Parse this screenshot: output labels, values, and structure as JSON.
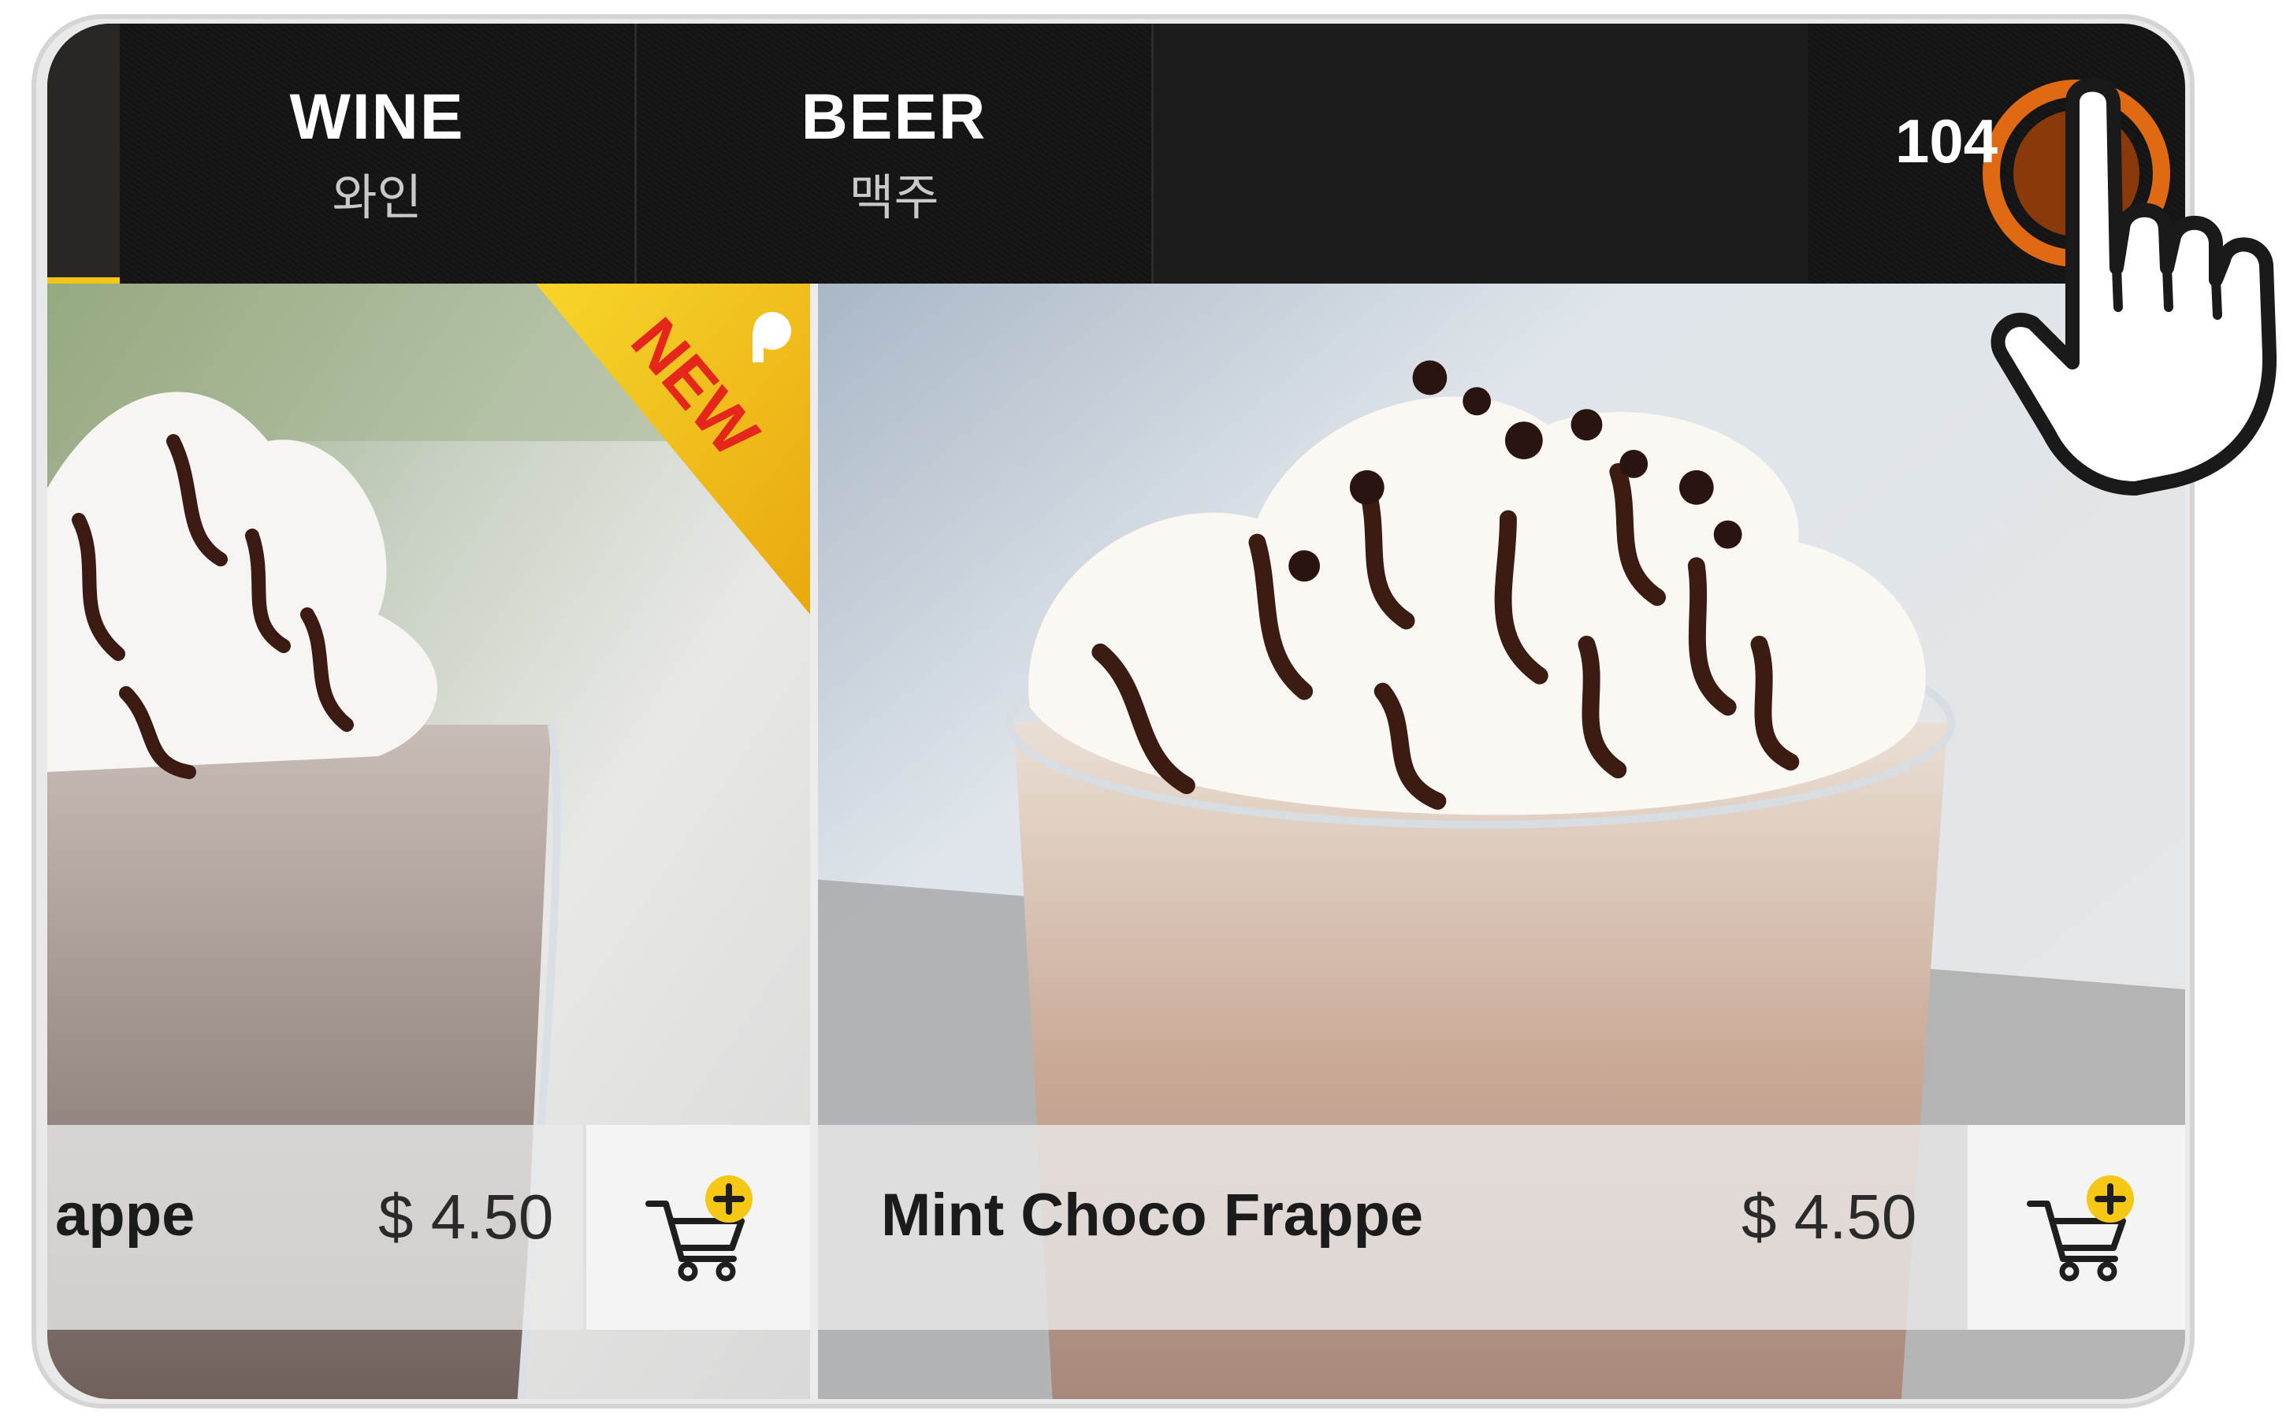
{
  "tabs": [
    {
      "title": "WINE",
      "subtitle": "와인"
    },
    {
      "title": "BEER",
      "subtitle": "맥주"
    }
  ],
  "header": {
    "counter": "104"
  },
  "badge": {
    "text": "NEW"
  },
  "products": [
    {
      "name": "appe",
      "price": "$ 4.50"
    },
    {
      "name": "Mint Choco Frappe",
      "price": "$ 4.50"
    }
  ],
  "colors": {
    "accent_yellow": "#f2c415",
    "tap_ring": "#e06a13",
    "tap_center": "#8a3a0a",
    "topbar": "#141414"
  },
  "icons": {
    "cart": "cart-add-icon",
    "pointer": "hand-pointer-icon"
  }
}
